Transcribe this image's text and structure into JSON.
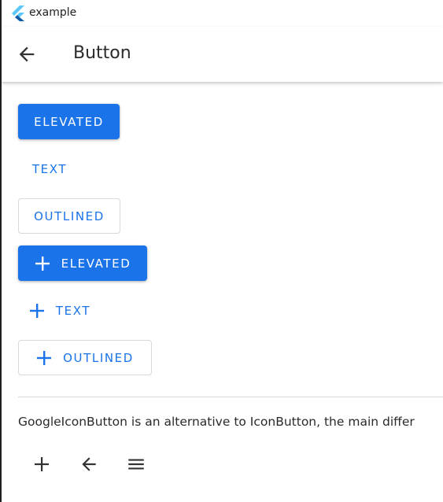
{
  "window": {
    "title": "example"
  },
  "appbar": {
    "title": "Button",
    "back_icon": "arrow-back-icon"
  },
  "buttons": {
    "elevated": "ELEVATED",
    "text": "TEXT",
    "outlined": "OUTLINED",
    "elevated_icon": "ELEVATED",
    "text_icon": "TEXT",
    "outlined_icon": "OUTLINED",
    "leading_icon": "plus-icon"
  },
  "description": "GoogleIconButton is an alternative to IconButton, the main differ",
  "icon_buttons": [
    {
      "icon": "plus-icon"
    },
    {
      "icon": "arrow-back-icon"
    },
    {
      "icon": "menu-icon"
    }
  ],
  "colors": {
    "accent": "#1a73e8",
    "on_accent": "#ffffff",
    "outline": "#d9d9d9",
    "text": "#2b2b2b"
  }
}
